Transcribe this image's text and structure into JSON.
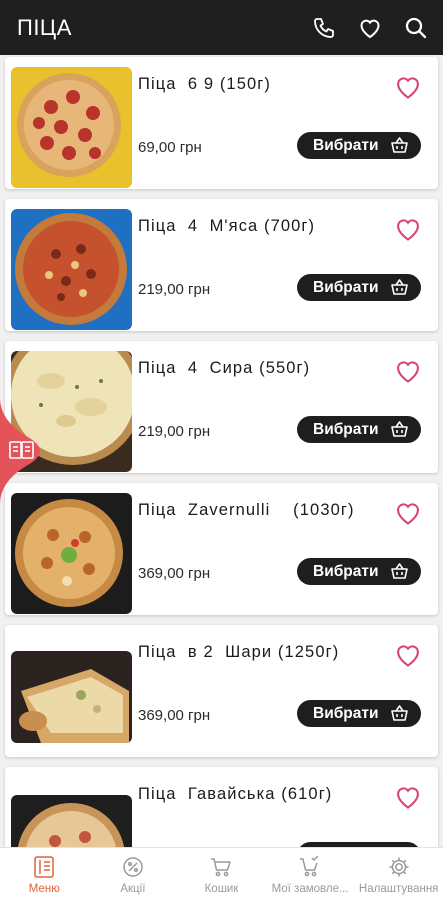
{
  "header": {
    "title": "ПІЦА",
    "icons": [
      "phone-icon",
      "heart-icon",
      "search-icon"
    ]
  },
  "products": [
    {
      "name": "Піца  6 9 (150г)",
      "price": "69,00 грн",
      "button": "Вибрати",
      "image": "pepperoni-pizza-yellow"
    },
    {
      "name": "Піца  4  М'яса (700г)",
      "price": "219,00 грн",
      "button": "Вибрати",
      "image": "meat-pizza-blue"
    },
    {
      "name": "Піца  4  Сира (550г)",
      "price": "219,00 грн",
      "button": "Вибрати",
      "image": "cheese-pizza"
    },
    {
      "name": "Піца  Zavernulli    (1030г)",
      "price": "369,00 грн",
      "button": "Вибрати",
      "image": "zavernulli-pizza-dark"
    },
    {
      "name": "Піца  в 2  Шари (1250г)",
      "price": "369,00 грн",
      "button": "Вибрати",
      "image": "two-layer-pizza"
    },
    {
      "name": "Піца  Гавайська (610г)",
      "price": "",
      "button": "",
      "image": "hawaiian-pizza"
    }
  ],
  "side_tab": {
    "icon": "book-icon"
  },
  "bottom_nav": [
    {
      "label": "Меню",
      "icon": "menu-icon",
      "active": true
    },
    {
      "label": "Акції",
      "icon": "discount-icon",
      "active": false
    },
    {
      "label": "Кошик",
      "icon": "cart-icon",
      "active": false
    },
    {
      "label": "Мої замовле...",
      "icon": "orders-icon",
      "active": false
    },
    {
      "label": "Налаштування",
      "icon": "settings-icon",
      "active": false
    }
  ],
  "colors": {
    "topbar": "#1f1f1f",
    "accent": "#e0623a",
    "heart": "#d9437a",
    "button": "#1e1e1e",
    "side_tab": "#e5535a"
  }
}
